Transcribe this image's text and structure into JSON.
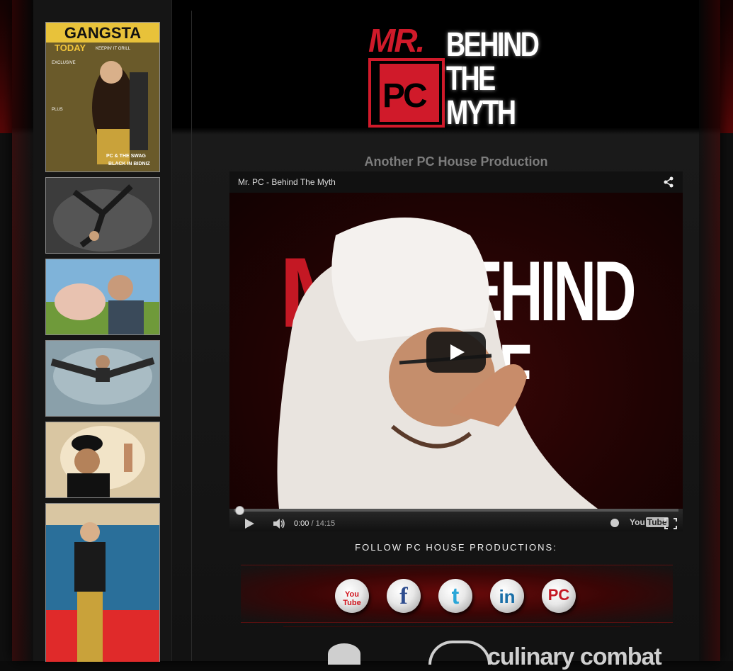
{
  "header": {
    "logo": {
      "mr": "MR.",
      "pc": "PC",
      "line1": "BEHIND",
      "line2": "THE",
      "line3": "MYTH"
    },
    "subtitle": "Another PC House Production"
  },
  "sidebar": {
    "magazine": {
      "title": "GANGSTA",
      "subtitle": "TODAY",
      "tag": "KEEPIN' IT GRILL",
      "exclusive": "EXCLUSIVE",
      "plus": "PLUS",
      "cover_line": "PC & THE SWAG",
      "cover_line2": "BLACK IN BIDNIZ"
    },
    "photos": [
      "breakdancer",
      "man-with-pig",
      "man-jumping-splits",
      "man-in-bowler-hat",
      "man-on-red-carpet"
    ]
  },
  "video": {
    "title": "Mr. PC - Behind The Myth",
    "current_time": "0:00",
    "duration": "14:15",
    "frame_text": {
      "m": "M",
      "ehind": "EHIND",
      "f": "F"
    },
    "brand": "You",
    "brand_tube": "Tube"
  },
  "follow": {
    "title": "FOLLOW PC HOUSE PRODUCTIONS:",
    "icons": [
      {
        "name": "youtube",
        "label": "You Tube",
        "color": "#d0121b"
      },
      {
        "name": "facebook",
        "label": "f",
        "color": "#2e4d8f"
      },
      {
        "name": "twitter",
        "label": "t",
        "color": "#2aa6d8"
      },
      {
        "name": "linkedin",
        "label": "in",
        "color": "#1a6fa8"
      },
      {
        "name": "pc-house",
        "label": "PC",
        "color": "#c41824"
      }
    ]
  },
  "sponsor": {
    "text": "culinary combat"
  },
  "colors": {
    "brand_red": "#d01a2a",
    "background": "#0c0c0c"
  }
}
